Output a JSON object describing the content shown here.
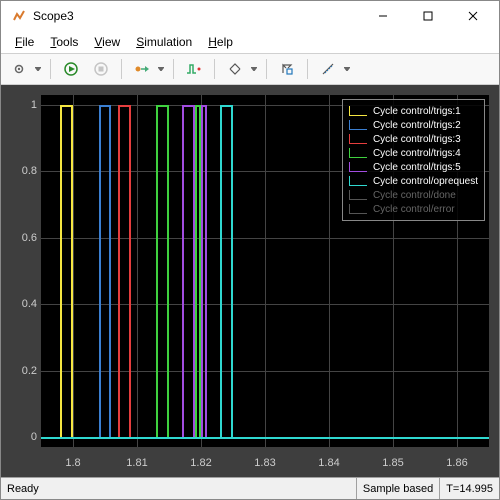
{
  "window": {
    "title": "Scope3"
  },
  "menu": {
    "file": "File",
    "tools": "Tools",
    "view": "View",
    "simulation": "Simulation",
    "help": "Help"
  },
  "status": {
    "ready": "Ready",
    "mode": "Sample based",
    "time": "T=14.995"
  },
  "legend": {
    "items": [
      {
        "label": "Cycle control/trigs:1",
        "color": "#f5e642",
        "dim": false
      },
      {
        "label": "Cycle control/trigs:2",
        "color": "#3b7fd1",
        "dim": false
      },
      {
        "label": "Cycle control/trigs:3",
        "color": "#e63e3e",
        "dim": false
      },
      {
        "label": "Cycle control/trigs:4",
        "color": "#3fd13f",
        "dim": false
      },
      {
        "label": "Cycle control/trigs:5",
        "color": "#a24de0",
        "dim": false
      },
      {
        "label": "Cycle control/oprequest",
        "color": "#2fd8d0",
        "dim": false
      },
      {
        "label": "Cycle control/done",
        "color": "#555555",
        "dim": true
      },
      {
        "label": "Cycle control/error",
        "color": "#555555",
        "dim": true
      }
    ]
  },
  "chart_data": {
    "type": "line",
    "title": "",
    "xlabel": "",
    "ylabel": "",
    "xlim": [
      1.795,
      1.865
    ],
    "ylim": [
      -0.03,
      1.03
    ],
    "x_ticks": [
      1.8,
      1.81,
      1.82,
      1.83,
      1.84,
      1.85,
      1.86
    ],
    "y_ticks": [
      0,
      0.2,
      0.4,
      0.6,
      0.8,
      1
    ],
    "series": [
      {
        "name": "Cycle control/trigs:1",
        "color": "#f5e642",
        "pulses": [
          [
            1.798,
            1.8
          ]
        ]
      },
      {
        "name": "Cycle control/trigs:2",
        "color": "#3b7fd1",
        "pulses": [
          [
            1.804,
            1.806
          ]
        ]
      },
      {
        "name": "Cycle control/trigs:3",
        "color": "#e63e3e",
        "pulses": [
          [
            1.807,
            1.809
          ]
        ]
      },
      {
        "name": "Cycle control/trigs:4",
        "color": "#3fd13f",
        "pulses": [
          [
            1.813,
            1.815
          ],
          [
            1.819,
            1.82
          ]
        ]
      },
      {
        "name": "Cycle control/trigs:5",
        "color": "#a24de0",
        "pulses": [
          [
            1.817,
            1.819
          ],
          [
            1.82,
            1.821
          ]
        ]
      },
      {
        "name": "Cycle control/oprequest",
        "color": "#2fd8d0",
        "pulses": [
          [
            1.823,
            1.825
          ]
        ]
      },
      {
        "name": "Cycle control/done",
        "color": "#555555",
        "pulses": []
      },
      {
        "name": "Cycle control/error",
        "color": "#555555",
        "pulses": []
      }
    ]
  }
}
